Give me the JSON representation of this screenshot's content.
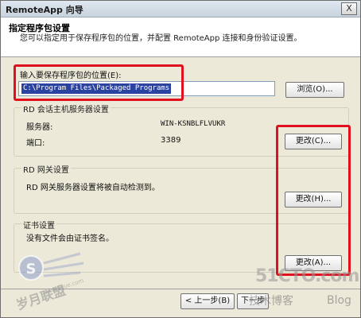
{
  "window": {
    "title": "RemoteApp 向导",
    "close_glyph": "X"
  },
  "header": {
    "heading": "指定程序包设置",
    "description": "您可以指定用于保存程序包的位置，并配置 RemoteApp 连接和身份验证设置。"
  },
  "location": {
    "label": "输入要保存程序包的位置(E):",
    "value": "C:\\Program Files\\Packaged Programs",
    "browse_label": "浏览(O)..."
  },
  "rdsh": {
    "group_title": "RD 会话主机服务器设置",
    "server_label": "服务器:",
    "server_value": "WIN-KSNBLFLVUKR",
    "port_label": "端口:",
    "port_value": "3389",
    "change_label": "更改(C)..."
  },
  "gateway": {
    "group_title": "RD 网关设置",
    "text": "RD 网关服务器设置将被自动检测到。",
    "change_label": "更改(H)..."
  },
  "cert": {
    "group_title": "证书设置",
    "text": "没有文件会由证书签名。",
    "change_label": "更改(A)..."
  },
  "footer": {
    "back_label": "< 上一步(B)",
    "next_label": "下一步"
  },
  "watermarks": {
    "left_text": "岁月联盟",
    "left_url": "www.Syue.com",
    "right_main": "51CTO.com",
    "right_sub": "技术博客",
    "right_blog": "Blog"
  },
  "colors": {
    "highlight_red": "#e0101e",
    "selection_blue": "#2b43a0"
  }
}
